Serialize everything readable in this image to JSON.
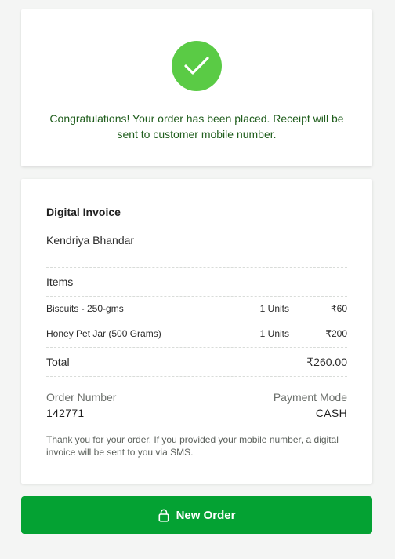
{
  "success": {
    "message": "Congratulations! Your order has been placed. Receipt will be sent to customer mobile number.",
    "check_icon": "check-icon",
    "accent_color": "#5acb45"
  },
  "invoice": {
    "title": "Digital Invoice",
    "shop_name": "Kendriya Bhandar",
    "items_heading": "Items",
    "items": [
      {
        "name": "Biscuits - 250-gms",
        "qty": "1 Units",
        "price": "₹60"
      },
      {
        "name": "Honey Pet Jar (500 Grams)",
        "qty": "1 Units",
        "price": "₹200"
      }
    ],
    "total_label": "Total",
    "total_value": "₹260.00",
    "order_number_label": "Order Number",
    "order_number": "142771",
    "payment_mode_label": "Payment Mode",
    "payment_mode": "CASH",
    "footnote": "Thank you for your order. If you provided your mobile number, a digital invoice will be sent to you via SMS."
  },
  "actions": {
    "new_order_label": "New Order",
    "new_order_icon": "lock-icon",
    "button_color": "#04a233"
  }
}
